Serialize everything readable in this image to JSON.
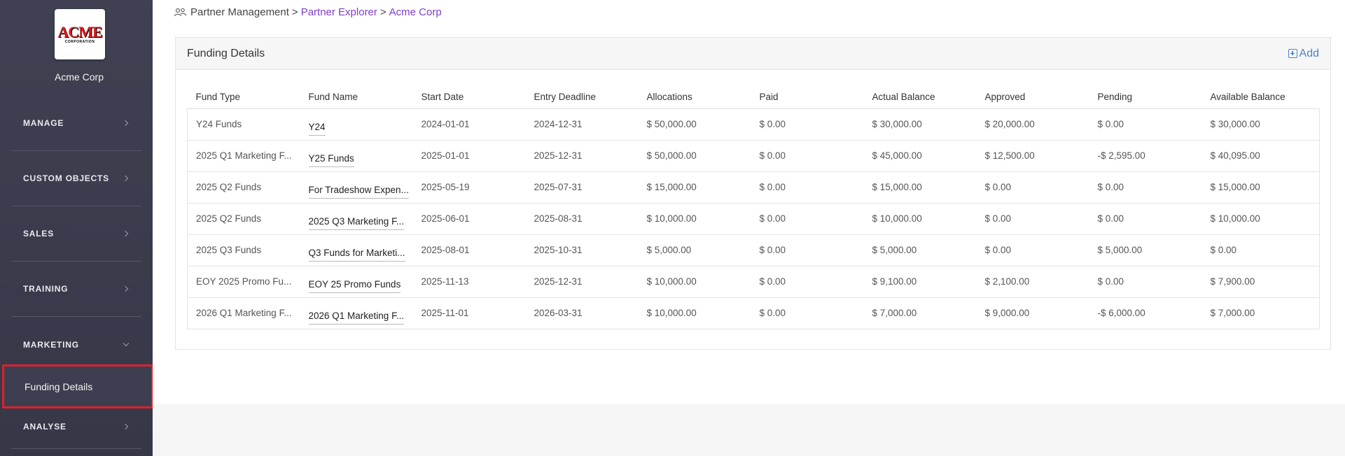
{
  "sidebar": {
    "logo": {
      "text": "ACME",
      "subtext": "CORPORATION",
      "color": "#d81e1e"
    },
    "org_name": "Acme Corp",
    "items": [
      {
        "label": "MANAGE",
        "expanded": false
      },
      {
        "label": "CUSTOM OBJECTS",
        "expanded": false
      },
      {
        "label": "SALES",
        "expanded": false
      },
      {
        "label": "TRAINING",
        "expanded": false
      },
      {
        "label": "MARKETING",
        "expanded": true
      },
      {
        "label": "ANALYSE",
        "expanded": false
      }
    ],
    "sub_item": {
      "label": "Funding Details",
      "highlight_color": "#e01f2b"
    }
  },
  "breadcrumb": {
    "root": "Partner Management",
    "separator": ">",
    "level1": "Partner Explorer",
    "level2": "Acme Corp",
    "link_color": "#7e3fc9"
  },
  "panel": {
    "title": "Funding Details",
    "add_label": "Add",
    "accent_color": "#4a86c5"
  },
  "table": {
    "columns": [
      "Fund Type",
      "Fund Name",
      "Start Date",
      "Entry Deadline",
      "Allocations",
      "Paid",
      "Actual Balance",
      "Approved",
      "Pending",
      "Available Balance"
    ],
    "rows": [
      [
        "Y24 Funds",
        "Y24",
        "2024-01-01",
        "2024-12-31",
        "$ 50,000.00",
        "$ 0.00",
        "$ 30,000.00",
        "$ 20,000.00",
        "$ 0.00",
        "$ 30,000.00"
      ],
      [
        "2025 Q1 Marketing F...",
        "Y25 Funds",
        "2025-01-01",
        "2025-12-31",
        "$ 50,000.00",
        "$ 0.00",
        "$ 45,000.00",
        "$ 12,500.00",
        "-$ 2,595.00",
        "$ 40,095.00"
      ],
      [
        "2025 Q2 Funds",
        "For Tradeshow Expen...",
        "2025-05-19",
        "2025-07-31",
        "$ 15,000.00",
        "$ 0.00",
        "$ 15,000.00",
        "$ 0.00",
        "$ 0.00",
        "$ 15,000.00"
      ],
      [
        "2025 Q2 Funds",
        "2025 Q3 Marketing F...",
        "2025-06-01",
        "2025-08-31",
        "$ 10,000.00",
        "$ 0.00",
        "$ 10,000.00",
        "$ 0.00",
        "$ 0.00",
        "$ 10,000.00"
      ],
      [
        "2025 Q3 Funds",
        "Q3 Funds for Marketi...",
        "2025-08-01",
        "2025-10-31",
        "$ 5,000.00",
        "$ 0.00",
        "$ 5,000.00",
        "$ 0.00",
        "$ 5,000.00",
        "$ 0.00"
      ],
      [
        "EOY 2025 Promo Fu...",
        "EOY 25 Promo Funds",
        "2025-11-13",
        "2025-12-31",
        "$ 10,000.00",
        "$ 0.00",
        "$ 9,100.00",
        "$ 2,100.00",
        "$ 0.00",
        "$ 7,900.00"
      ],
      [
        "2026 Q1 Marketing F...",
        "2026 Q1 Marketing F...",
        "2025-11-01",
        "2026-03-31",
        "$ 10,000.00",
        "$ 0.00",
        "$ 7,000.00",
        "$ 9,000.00",
        "-$ 6,000.00",
        "$ 7,000.00"
      ]
    ]
  }
}
